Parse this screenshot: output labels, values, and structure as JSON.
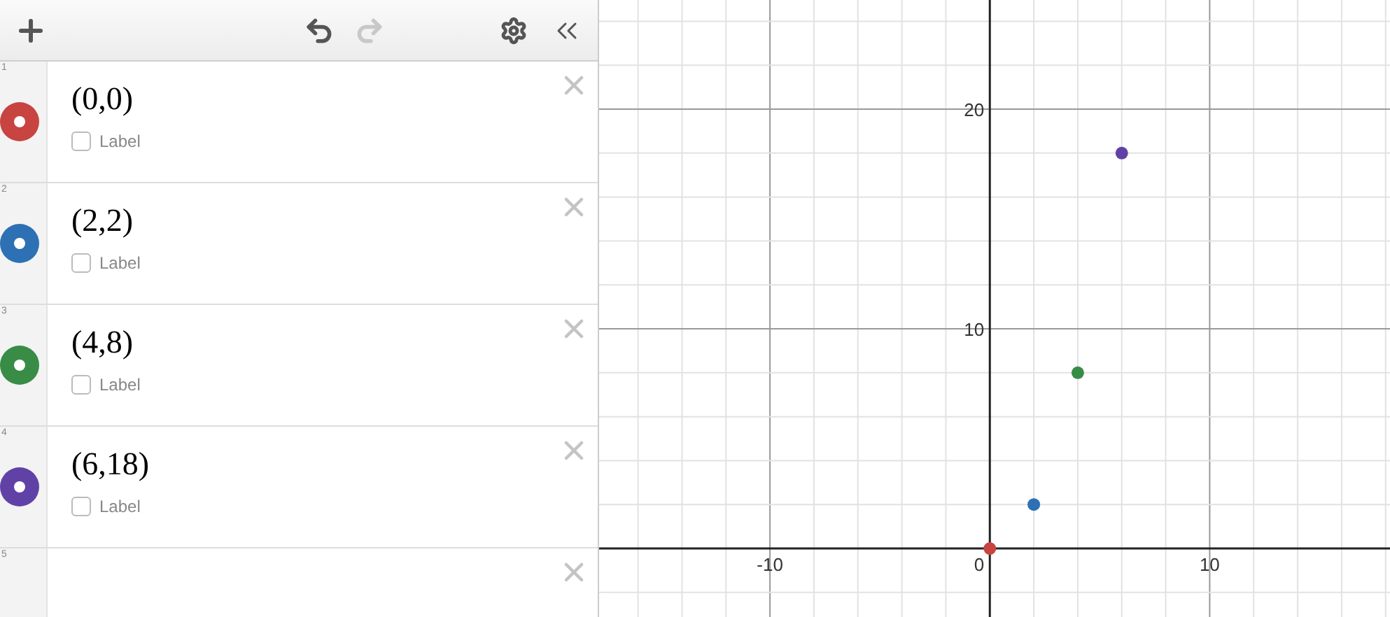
{
  "toolbar": {
    "undo_disabled": false,
    "redo_disabled": true
  },
  "expressions": [
    {
      "number": "1",
      "text": "(0,0)",
      "color": "#c74440",
      "label": {
        "text": "Label",
        "checked": false
      }
    },
    {
      "number": "2",
      "text": "(2,2)",
      "color": "#2d70b3",
      "label": {
        "text": "Label",
        "checked": false
      }
    },
    {
      "number": "3",
      "text": "(4,8)",
      "color": "#388c46",
      "label": {
        "text": "Label",
        "checked": false
      }
    },
    {
      "number": "4",
      "text": "(6,18)",
      "color": "#6042a6",
      "label": {
        "text": "Label",
        "checked": false
      }
    },
    {
      "number": "5"
    }
  ],
  "graph": {
    "chart_data": {
      "type": "scatter",
      "x": [
        0,
        2,
        4,
        6
      ],
      "series": [
        {
          "color": "#c74440",
          "values": [
            0,
            null,
            null,
            null
          ]
        },
        {
          "color": "#2d70b3",
          "values": [
            null,
            2,
            null,
            null
          ]
        },
        {
          "color": "#388c46",
          "values": [
            null,
            null,
            8,
            null
          ]
        },
        {
          "color": "#6042a6",
          "values": [
            null,
            null,
            null,
            18
          ]
        }
      ],
      "xlim": [
        -17.77,
        18.2
      ],
      "ylim": [
        -3.12,
        24.97
      ],
      "xticks": [
        -10,
        10
      ],
      "yticks": [
        10,
        20
      ],
      "grid": true
    },
    "origin_label": "0"
  }
}
